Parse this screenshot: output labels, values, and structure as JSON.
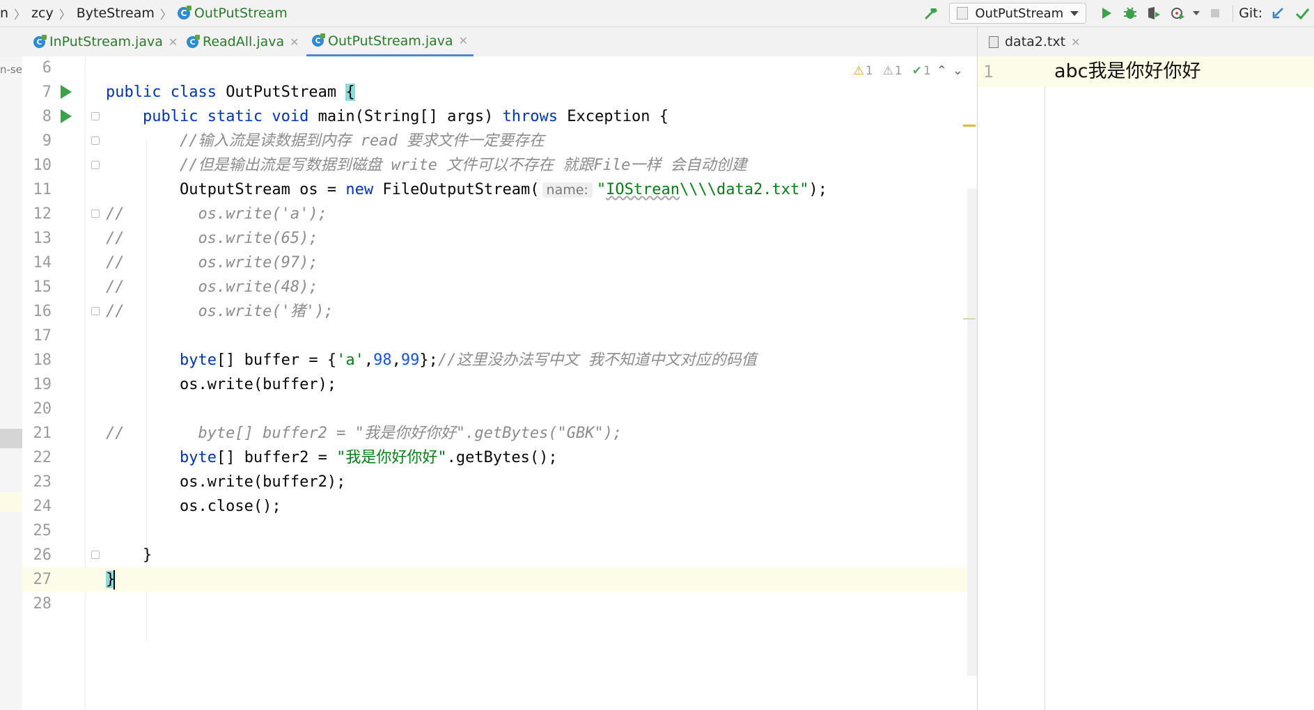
{
  "breadcrumb": {
    "cut": "n",
    "items": [
      "zcy",
      "ByteStream",
      "OutPutStream"
    ]
  },
  "toolbar": {
    "run_config": "OutPutStream",
    "git_label": "Git:"
  },
  "tabs": [
    {
      "label": "InPutStream.java",
      "active": false
    },
    {
      "label": "ReadAll.java",
      "active": false
    },
    {
      "label": "OutPutStream.java",
      "active": true
    }
  ],
  "txt_tab": {
    "label": "data2.txt"
  },
  "left_strip": {
    "cut_text": "n-se"
  },
  "inspections": {
    "warnings": "1",
    "weak_warnings": "1",
    "typos": "1"
  },
  "icons": [
    "build-hammer-icon",
    "run-icon",
    "debug-icon",
    "coverage-icon",
    "profile-icon",
    "stop-icon",
    "git-update-icon",
    "git-commit-icon",
    "class-icon",
    "text-file-icon",
    "close-icon",
    "chevron-up-icon",
    "chevron-down-icon",
    "fold-icon"
  ],
  "colors": {
    "keyword": "#0033b3",
    "string": "#067d17",
    "number": "#1750eb",
    "comment": "#8c8c8c",
    "run_green": "#3aa24b",
    "current_line": "#fdfce9"
  },
  "editor": {
    "lines": [
      {
        "n": "6",
        "t": []
      },
      {
        "n": "7",
        "run": true,
        "t": [
          [
            "kw",
            "public class "
          ],
          [
            "p",
            "OutPutStream "
          ],
          [
            "bh",
            "{"
          ]
        ]
      },
      {
        "n": "8",
        "run": true,
        "fold": true,
        "t": [
          [
            "p",
            "    "
          ],
          [
            "kw",
            "public static void "
          ],
          [
            "p",
            "main(String[] args) "
          ],
          [
            "kw",
            "throws "
          ],
          [
            "p",
            "Exception {"
          ]
        ]
      },
      {
        "n": "9",
        "fold": true,
        "t": [
          [
            "p",
            "        "
          ],
          [
            "c",
            "//输入流是读数据到内存 read 要求文件一定要存在"
          ]
        ]
      },
      {
        "n": "10",
        "fold": true,
        "t": [
          [
            "p",
            "        "
          ],
          [
            "c",
            "//但是输出流是写数据到磁盘 write 文件可以不存在 就跟File一样 会自动创建"
          ]
        ]
      },
      {
        "n": "11",
        "t": [
          [
            "p",
            "        OutputStream os = "
          ],
          [
            "kw",
            "new "
          ],
          [
            "p",
            "FileOutputStream("
          ],
          [
            "h",
            "name:"
          ],
          [
            "s",
            "\""
          ],
          [
            "sq",
            "IOStrean"
          ],
          [
            "s",
            "\\\\\\\\data2.txt\""
          ],
          [
            "p",
            ");"
          ]
        ]
      },
      {
        "n": "12",
        "fold": true,
        "t": [
          [
            "c",
            "//        os.write('a');"
          ]
        ]
      },
      {
        "n": "13",
        "t": [
          [
            "c",
            "//        os.write(65);"
          ]
        ]
      },
      {
        "n": "14",
        "t": [
          [
            "c",
            "//        os.write(97);"
          ]
        ]
      },
      {
        "n": "15",
        "t": [
          [
            "c",
            "//        os.write(48);"
          ]
        ]
      },
      {
        "n": "16",
        "fold": true,
        "t": [
          [
            "c",
            "//        os.write('猪');"
          ]
        ]
      },
      {
        "n": "17",
        "t": []
      },
      {
        "n": "18",
        "t": [
          [
            "p",
            "        "
          ],
          [
            "kw",
            "byte"
          ],
          [
            "p",
            "[] buffer = {"
          ],
          [
            "s",
            "'a'"
          ],
          [
            "p",
            ","
          ],
          [
            "num",
            "98"
          ],
          [
            "p",
            ","
          ],
          [
            "num",
            "99"
          ],
          [
            "p",
            "};"
          ],
          [
            "c",
            "//这里没办法写中文 我不知道中文对应的码值"
          ]
        ]
      },
      {
        "n": "19",
        "t": [
          [
            "p",
            "        os.write(buffer);"
          ]
        ]
      },
      {
        "n": "20",
        "t": []
      },
      {
        "n": "21",
        "t": [
          [
            "c",
            "//        byte[] buffer2 = \"我是你好你好\".getBytes(\"GBK\");"
          ]
        ]
      },
      {
        "n": "22",
        "t": [
          [
            "p",
            "        "
          ],
          [
            "kw",
            "byte"
          ],
          [
            "p",
            "[] buffer2 = "
          ],
          [
            "s",
            "\"我是你好你好\""
          ],
          [
            "p",
            ".getBytes();"
          ]
        ]
      },
      {
        "n": "23",
        "t": [
          [
            "p",
            "        os.write(buffer2);"
          ]
        ]
      },
      {
        "n": "24",
        "t": [
          [
            "p",
            "        os.close();"
          ]
        ]
      },
      {
        "n": "25",
        "t": []
      },
      {
        "n": "26",
        "fold": true,
        "t": [
          [
            "p",
            "    }"
          ]
        ]
      },
      {
        "n": "27",
        "current": true,
        "t": [
          [
            "bh",
            "}"
          ]
        ]
      },
      {
        "n": "28",
        "t": []
      }
    ]
  },
  "txt_editor": {
    "line_number": "1",
    "content": "abc我是你好你好"
  }
}
